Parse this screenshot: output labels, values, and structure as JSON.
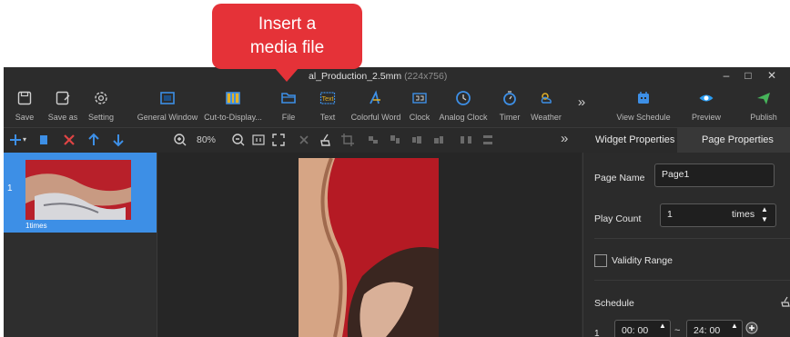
{
  "window": {
    "title_main": "al_Production_2.5mm",
    "title_dims": "(224x756)",
    "minimize": "–",
    "maximize": "□",
    "close": "✕"
  },
  "toolbar": {
    "items": [
      {
        "label": "Save"
      },
      {
        "label": "Save as"
      },
      {
        "label": "Setting"
      },
      {
        "label": "General Window"
      },
      {
        "label": "Cut-to-Display..."
      },
      {
        "label": "File"
      },
      {
        "label": "Text"
      },
      {
        "label": "Colorful Word"
      },
      {
        "label": "Clock"
      },
      {
        "label": "Analog Clock"
      },
      {
        "label": "Timer"
      },
      {
        "label": "Weather"
      },
      {
        "label": "View Schedule"
      },
      {
        "label": "Preview"
      },
      {
        "label": "Publish"
      }
    ],
    "more": "»",
    "text_icon_label": "Text"
  },
  "secondary_toolbar": {
    "zoom_level": "80%",
    "more": "»"
  },
  "page_list": {
    "items": [
      {
        "index": "1",
        "label": "1times"
      }
    ]
  },
  "properties": {
    "tabs": [
      "Widget Properties",
      "Page Properties"
    ],
    "page_name_label": "Page Name",
    "page_name_value": "Page1",
    "play_count_label": "Play Count",
    "play_count_value": "1",
    "play_count_unit": "times",
    "validity_label": "Validity Range",
    "schedule_label": "Schedule",
    "schedule_row_index": "1",
    "schedule_start": "00: 00",
    "schedule_separator": "~",
    "schedule_end": "24: 00"
  },
  "callout": {
    "text_line1": "Insert a",
    "text_line2": "media file"
  },
  "colors": {
    "accent_blue": "#3d8fe6",
    "callout_red": "#e53238",
    "app_bg": "#2c2c2c",
    "publish_green": "#46b45a",
    "preview_blue": "#2a9df4",
    "delete_red": "#e04444"
  }
}
